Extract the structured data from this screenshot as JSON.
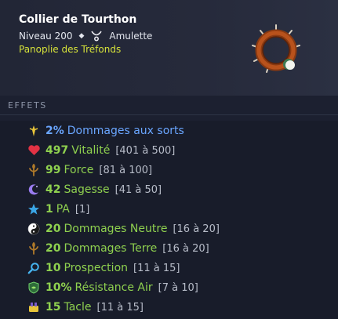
{
  "item": {
    "name": "Collier de Tourthon",
    "level": "Niveau 200",
    "type": "Amulette",
    "set": "Panoplie des Tréfonds"
  },
  "section": {
    "label": "EFFETS"
  },
  "effects": [
    {
      "icon": "damage-spell-icon",
      "value": "2%",
      "name": "Dommages aux sorts",
      "range": ""
    },
    {
      "icon": "heart-icon",
      "value": "497",
      "name": "Vitalité",
      "range": "[401 à 500]"
    },
    {
      "icon": "strength-icon",
      "value": "99",
      "name": "Force",
      "range": "[81 à 100]"
    },
    {
      "icon": "wisdom-icon",
      "value": "42",
      "name": "Sagesse",
      "range": "[41 à 50]"
    },
    {
      "icon": "ap-star-icon",
      "value": "1",
      "name": "PA",
      "range": "[1]"
    },
    {
      "icon": "yin-yang-icon",
      "value": "20",
      "name": "Dommages Neutre",
      "range": "[16 à 20]"
    },
    {
      "icon": "earth-icon",
      "value": "20",
      "name": "Dommages Terre",
      "range": "[16 à 20]"
    },
    {
      "icon": "prospection-icon",
      "value": "10",
      "name": "Prospection",
      "range": "[11 à 15]"
    },
    {
      "icon": "air-shield-icon",
      "value": "10%",
      "name": "Résistance Air",
      "range": "[7 à 10]"
    },
    {
      "icon": "tackle-icon",
      "value": "15",
      "name": "Tacle",
      "range": "[11 à 15]"
    }
  ],
  "colors": {
    "positive": "#8fd14f",
    "special": "#6aa6ff",
    "set": "#d6e23a"
  }
}
